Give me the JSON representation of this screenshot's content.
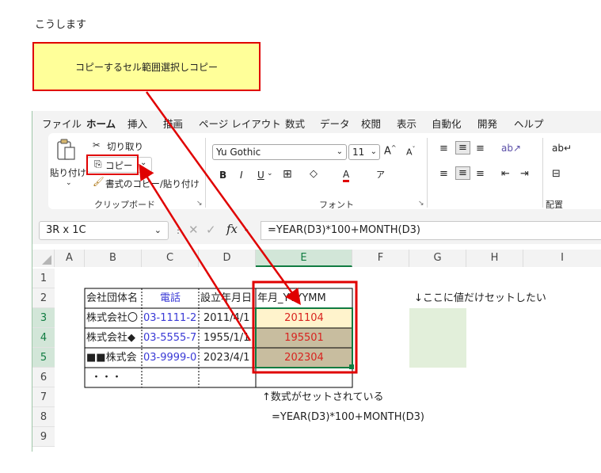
{
  "intro": "こうします",
  "callout": "コピーするセル範囲選択しコピー",
  "menu": [
    "ファイル",
    "ホーム",
    "挿入",
    "描画",
    "ページ レイアウト",
    "数式",
    "データ",
    "校閲",
    "表示",
    "自動化",
    "開発",
    "ヘルプ"
  ],
  "ribbon": {
    "paste": "貼り付け",
    "cut": "切り取り",
    "copy": "コピー",
    "format_painter": "書式のコピー/貼り付け",
    "clipboard_label": "クリップボード",
    "font_name": "Yu Gothic",
    "font_size": "11",
    "font_label": "フォント",
    "align_label": "配置"
  },
  "formula": {
    "name_box": "3R x 1C",
    "fx": "fx",
    "value": "=YEAR(D3)*100+MONTH(D3)"
  },
  "columns": [
    "A",
    "B",
    "C",
    "D",
    "E",
    "F",
    "G",
    "H",
    "I"
  ],
  "rows": [
    "1",
    "2",
    "3",
    "4",
    "5",
    "6",
    "7",
    "8",
    "9"
  ],
  "table": {
    "headers": [
      "会社団体名",
      "電話",
      "設立年月日",
      "年月_YYYYMM"
    ],
    "rows": [
      [
        "株式会社〇",
        "03-1111-2",
        "2011/4/1",
        "201104"
      ],
      [
        "株式会社◆",
        "03-5555-7",
        "1955/1/1",
        "195501"
      ],
      [
        "■■株式会",
        "03-9999-0",
        "2023/4/1",
        "202304"
      ],
      [
        "・・・",
        "",
        "",
        ""
      ]
    ]
  },
  "note_right": "↓ここに値だけセットしたい",
  "note_below1": "↑数式がセットされている",
  "note_below2": "=YEAR(D3)*100+MONTH(D3)",
  "colors": {
    "accent": "#107c41",
    "highlight": "#e00000",
    "callout_bg": "#ffff99",
    "selected_cell": "#c8bd9f",
    "target_area": "#e2efda",
    "first_row": "#fff3cc"
  }
}
